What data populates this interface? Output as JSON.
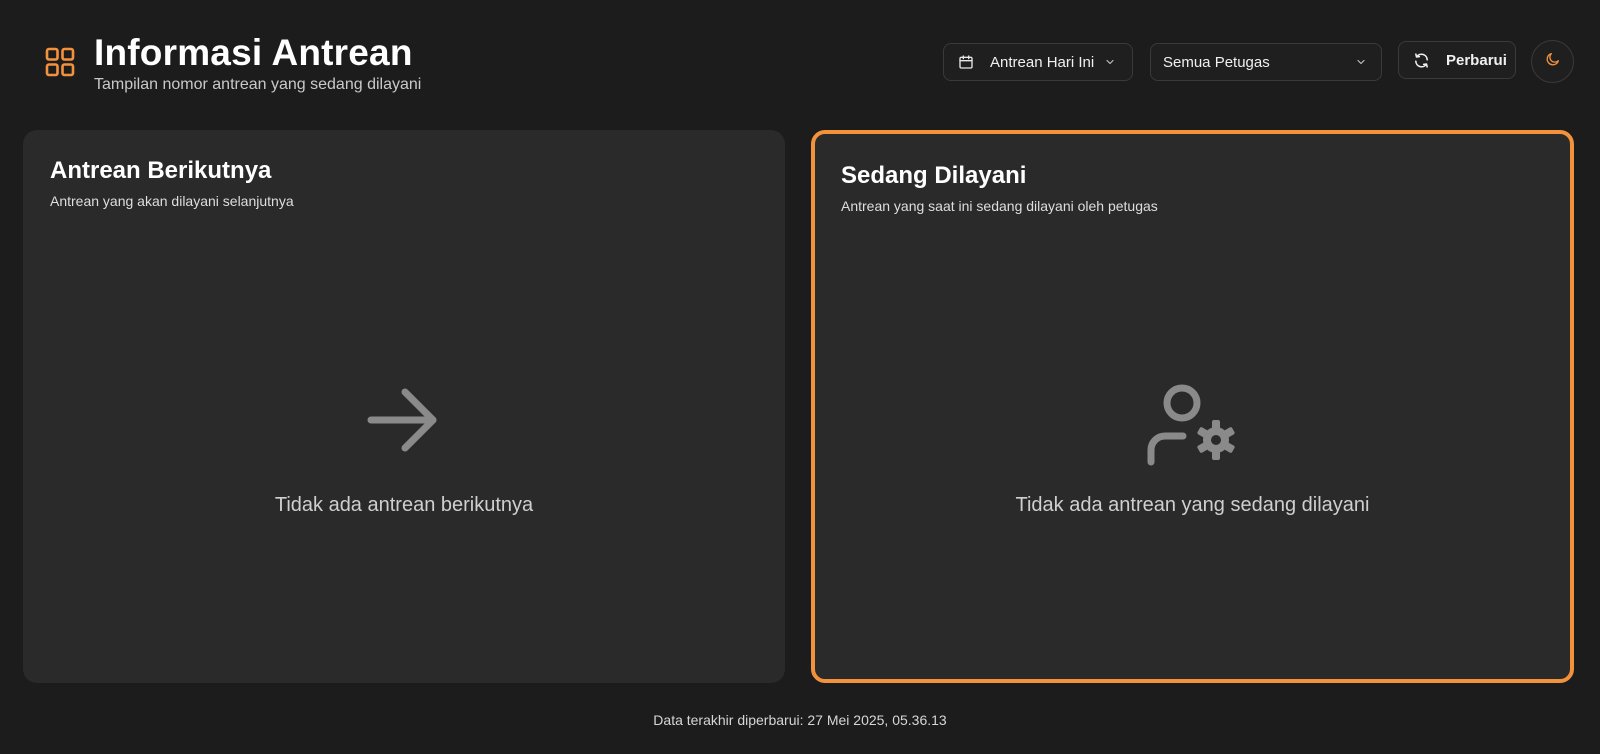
{
  "header": {
    "title": "Informasi Antrean",
    "subtitle": "Tampilan nomor antrean yang sedang dilayani",
    "brand_icon": "dashboard-grid-icon",
    "date_filter": {
      "icon": "calendar-icon",
      "value": "Antrean Hari Ini"
    },
    "staff_filter": {
      "value": "Semua Petugas"
    },
    "refresh_button": {
      "icon": "refresh-icon",
      "label": "Perbarui"
    },
    "theme_toggle": {
      "icon": "moon-icon"
    }
  },
  "cards": {
    "next": {
      "title": "Antrean Berikutnya",
      "subtitle": "Antrean yang akan dilayani selanjutnya",
      "empty_icon": "arrow-right-icon",
      "empty_text": "Tidak ada antrean berikutnya"
    },
    "serving": {
      "title": "Sedang Dilayani",
      "subtitle": "Antrean yang saat ini sedang dilayani oleh petugas",
      "empty_icon": "user-cog-icon",
      "empty_text": "Tidak ada antrean yang sedang dilayani"
    }
  },
  "footer": {
    "last_updated": "Data terakhir diperbarui: 27 Mei 2025, 05.36.13"
  },
  "colors": {
    "background": "#1c1c1c",
    "card": "#2a2a2a",
    "accent": "#f3923c",
    "muted_icon": "#8a8a8a"
  }
}
